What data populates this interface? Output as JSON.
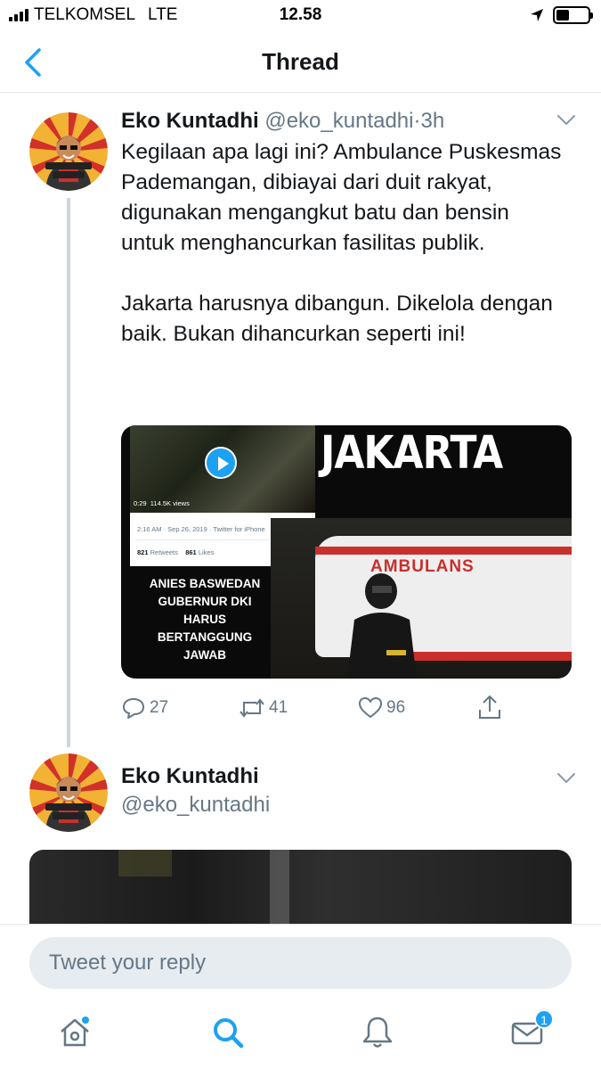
{
  "status_bar": {
    "carrier": "TELKOMSEL",
    "network": "LTE",
    "time": "12.58",
    "battery_level": 0.4
  },
  "nav": {
    "title": "Thread",
    "back_icon": "chevron-left-icon"
  },
  "tweets": [
    {
      "name": "Eko Kuntadhi",
      "handle": "@eko_kuntadhi",
      "separator": "·",
      "time": "3h",
      "avatar_text": "MASYOOK PAK EKO!",
      "text": "Kegilaan apa lagi ini? Ambulance Puskesmas Pademangan, dibiayai dari duit rakyat, digunakan mengangkut batu dan bensin untuk menghancurkan fasilitas publik.\n\nJakarta harusnya dibangun. Dikelola dengan baik. Bukan dihancurkan seperti ini!",
      "media": {
        "embed_duration": "0:29",
        "embed_views": "114.5K views",
        "embed_date": "2:16 AM · Sep 26, 2019 · Twitter for iPhone",
        "embed_retweets_count": "821",
        "embed_retweets_label": "Retweets",
        "embed_likes_count": "861",
        "embed_likes_label": "Likes",
        "headline": "JAKARTA",
        "vehicle_label": "AMBULANS",
        "caption": "ANIES BASWEDAN\nGUBERNUR DKI\nHARUS\nBERTANGGUNG\nJAWAB"
      },
      "actions": {
        "replies": "27",
        "retweets": "41",
        "likes": "96"
      }
    },
    {
      "name": "Eko Kuntadhi",
      "handle": "@eko_kuntadhi",
      "avatar_text": "MASYOOK PAK EKO!"
    }
  ],
  "reply": {
    "placeholder": "Tweet your reply"
  },
  "tabs": [
    {
      "name": "home",
      "icon": "home-icon",
      "has_dot": true
    },
    {
      "name": "search",
      "icon": "search-icon",
      "active": true
    },
    {
      "name": "notifications",
      "icon": "bell-icon"
    },
    {
      "name": "messages",
      "icon": "mail-icon",
      "badge": "1"
    }
  ],
  "colors": {
    "accent": "#1da1f2",
    "text": "#14171a",
    "secondary": "#657786",
    "divider": "#e1e8ed",
    "thread_line": "#ccd6dd"
  }
}
